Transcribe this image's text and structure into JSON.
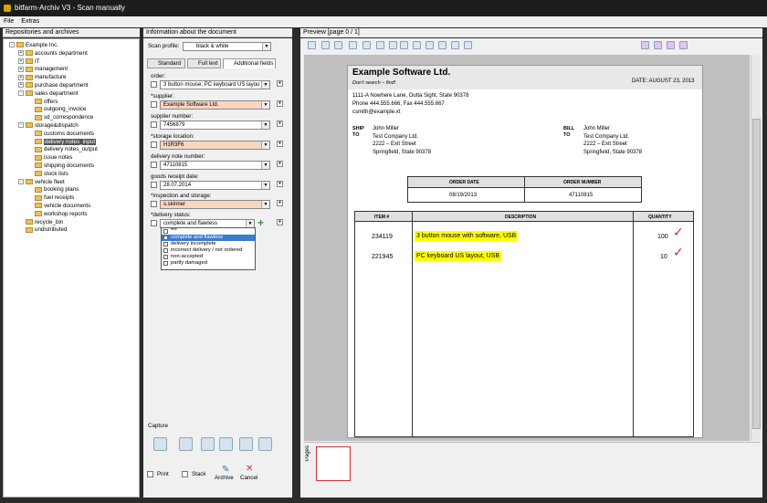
{
  "window": {
    "title": "bitfarm-Archiv V3 - Scan manually"
  },
  "menu": {
    "file": "File",
    "extras": "Extras"
  },
  "repos": {
    "header": "Repositories and archives",
    "items": [
      {
        "label": "Example Inc.",
        "exp": "-"
      },
      {
        "label": "accounts department",
        "exp": "+"
      },
      {
        "label": "IT",
        "exp": "+"
      },
      {
        "label": "management",
        "exp": "+"
      },
      {
        "label": "manufacture",
        "exp": "+"
      },
      {
        "label": "purchase department",
        "exp": "+"
      },
      {
        "label": "sales department",
        "exp": "-"
      },
      {
        "label": "offers",
        "exp": ""
      },
      {
        "label": "outgoing_invoice",
        "exp": ""
      },
      {
        "label": "sd_correspondence",
        "exp": ""
      },
      {
        "label": "storage&dispatch",
        "exp": "-"
      },
      {
        "label": "customs documents",
        "exp": ""
      },
      {
        "label": "delivery notes_input",
        "exp": ""
      },
      {
        "label": "delivery notes_output",
        "exp": ""
      },
      {
        "label": "issue notes",
        "exp": ""
      },
      {
        "label": "shipping documents",
        "exp": ""
      },
      {
        "label": "stock lists",
        "exp": ""
      },
      {
        "label": "vehicle fleet",
        "exp": "-"
      },
      {
        "label": "booking plans",
        "exp": ""
      },
      {
        "label": "fuel receipts",
        "exp": ""
      },
      {
        "label": "vehicle documents",
        "exp": ""
      },
      {
        "label": "workshop reports",
        "exp": ""
      },
      {
        "label": "recycle_bin",
        "exp": ""
      },
      {
        "label": "undistributed",
        "exp": ""
      }
    ]
  },
  "info": {
    "header": "Information about the document",
    "scan_profile_label": "Scan profile:",
    "scan_profile_value": "black & white",
    "tabs": [
      "Standard",
      "Full text",
      "Additional fields"
    ],
    "fields": [
      {
        "label": "order:",
        "value": "3 button mouse; PC keyboard US layou"
      },
      {
        "label": "*supplier:",
        "value": "Example Software Ltd."
      },
      {
        "label": "supplier number:",
        "value": "7456879"
      },
      {
        "label": "*storage location:",
        "value": "H1R3F6"
      },
      {
        "label": "delivery note number:",
        "value": "47110815"
      },
      {
        "label": "goods receipt date:",
        "value": "28.07.2014"
      },
      {
        "label": "*inspection and storage:",
        "value": "s.skinner"
      },
      {
        "label": "*delivery status:",
        "value": "complete and flawless"
      }
    ],
    "dropdown": [
      "***",
      "complete and flawless",
      "delivery incomplete",
      "incorrect delivery / not ordered",
      "non-accepted",
      "partly damaged"
    ],
    "capture_label": "Capture",
    "print": "Print",
    "stack": "Stack",
    "archive": "Archive",
    "cancel": "Cancel"
  },
  "preview": {
    "header": "Preview [page 0 / 1]",
    "pages_label": "Pages"
  },
  "doc": {
    "company": "Example Software Ltd.",
    "tagline": "Don't search – find!",
    "date": "DATE: AUGUST 23, 2013",
    "addr1": "1111-A Nowhere Lane, Outta Sight, State 90378",
    "addr2": "Phone 444.555.666, Fax 444.555.667",
    "addr3": "csmith@example.xt",
    "ship_to": "SHIP",
    "to1": "TO",
    "bill": "BILL",
    "to2": "TO",
    "ship_lines": [
      "John Miller",
      "Test Company Ltd.",
      "2222 – Exit Street",
      "Springfield, State 90378"
    ],
    "bill_lines": [
      "John Miller",
      "Test Company Ltd.",
      "2222 – Exit Street",
      "Springfield, State 90378"
    ],
    "order_date_h": "ORDER DATE",
    "order_number_h": "ORDER NUMBER",
    "order_date": "08/19/2013",
    "order_number": "47110815",
    "item_h": "ITEM #",
    "desc_h": "DESCRIPTION",
    "qty_h": "QUANTITY",
    "rows": [
      {
        "item": "234119",
        "desc": "3 button mouse with software, USB",
        "qty": "100"
      },
      {
        "item": "221945",
        "desc": "PC keyboard US layout, USB",
        "qty": "10"
      }
    ]
  }
}
